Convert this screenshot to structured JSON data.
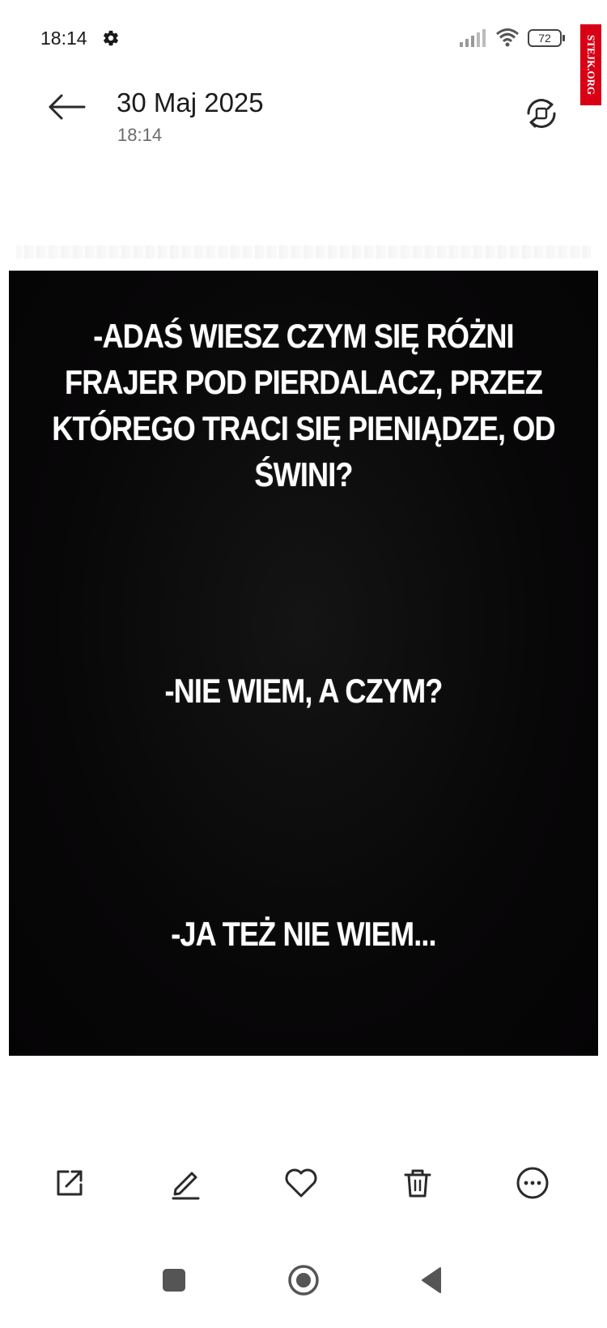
{
  "status_bar": {
    "time": "18:14",
    "battery": "72"
  },
  "watermark": {
    "text": "STEJK.ORG"
  },
  "header": {
    "date": "30 Maj 2025",
    "time": "18:14"
  },
  "image": {
    "lines": [
      "-ADAŚ WIESZ CZYM SIĘ RÓŻNI FRAJER POD PIERDALACZ, PRZEZ KTÓREGO TRACI SIĘ PIENIĄDZE, OD ŚWINI?",
      "-NIE WIEM, A CZYM?",
      "-JA TEŻ NIE WIEM..."
    ],
    "background_color": "#070607",
    "text_color": "#ffffff"
  },
  "actions": {
    "share": "share-icon",
    "edit": "edit-icon",
    "favorite": "heart-icon",
    "delete": "trash-icon",
    "more": "more-icon"
  },
  "nav": {
    "recents": "square-icon",
    "home": "circle-icon",
    "back": "triangle-back-icon"
  },
  "colors": {
    "accent_watermark": "#d90016",
    "icon": "#2a2a2a"
  }
}
